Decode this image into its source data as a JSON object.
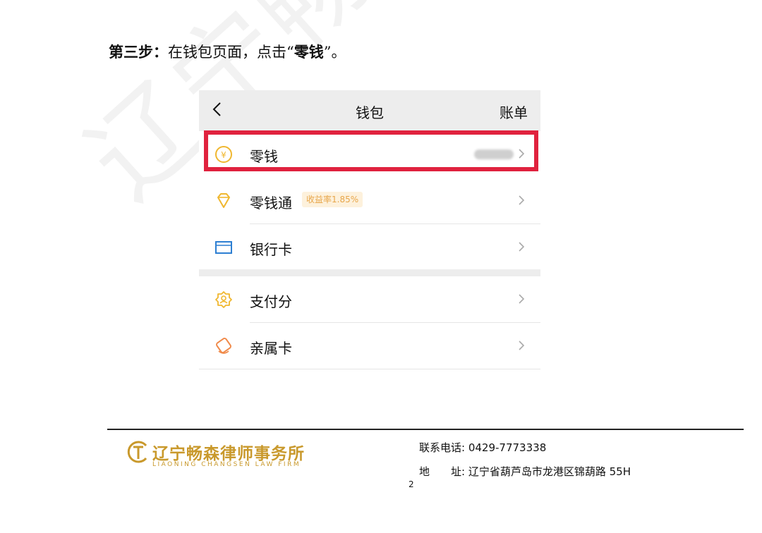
{
  "watermark": "辽宁畅森律",
  "step": {
    "prefix": "第三步：",
    "body": "在钱包页面，点击",
    "quote_open": "“",
    "target": "零钱",
    "quote_close": "”。"
  },
  "wallet": {
    "title": "钱包",
    "bill_label": "账单",
    "items": [
      {
        "label": "零钱",
        "icon": "coin-icon"
      },
      {
        "label": "零钱通",
        "icon": "diamond-icon",
        "badge": "收益率1.85%"
      },
      {
        "label": "银行卡",
        "icon": "bank-card-icon"
      },
      {
        "label": "支付分",
        "icon": "score-badge-icon"
      },
      {
        "label": "亲属卡",
        "icon": "family-card-icon"
      }
    ]
  },
  "colors": {
    "highlight": "#e0223e",
    "icon_gold": "#f0b72f",
    "icon_blue": "#2d7fd2",
    "logo_gold": "#c9992c"
  },
  "footer": {
    "logo_cn": "辽宁畅森律师事务所",
    "logo_en": "LIAONING CHANGSEN LAW FIRM",
    "phone_label": "联系电话:",
    "phone": "0429-7773338",
    "address_label": "地　　址:",
    "address": "辽宁省葫芦岛市龙港区锦葫路 55H",
    "page_number": "2"
  }
}
